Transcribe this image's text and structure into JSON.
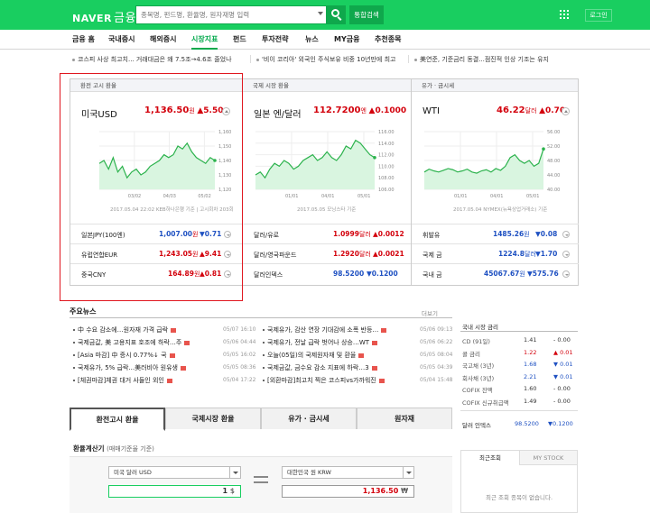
{
  "header": {
    "logo_naver": "NAVER",
    "logo_finance": "금융",
    "search_placeholder": "종목명, 펀드명, 환율명, 원자재명 입력",
    "search_all": "통합검색",
    "login": "로그인"
  },
  "nav": [
    "금융 홈",
    "국내증시",
    "해외증시",
    "시장지표",
    "펀드",
    "투자전략",
    "뉴스",
    "MY금융",
    "추천종목"
  ],
  "nav_active": "시장지표",
  "ticker": [
    "코스피 사상 최고치... 거래대금은 왜 7.5조→4.6조 줄었나",
    "'비이 코리아' 외국인 주식보유 비중 10년만에 최고",
    "美연준, 기준금리 동결...점진적 인상 기조는 유지"
  ],
  "panels": [
    {
      "header": "환전 고시 환율",
      "name": "미국USD",
      "value": "1,136.50",
      "unit": "원",
      "change": "5.50",
      "dir": "up",
      "yticks": [
        "1,160",
        "1,150",
        "1,140",
        "1,130",
        "1,120"
      ],
      "xticks": [
        "03/02",
        "04/03",
        "05/02"
      ],
      "note": "2017.05.04 22:02 KEB하나은행 기준",
      "note2": "고시회차 203회",
      "rows": [
        {
          "label": "일본JPY(100엔)",
          "value": "1,007.00",
          "unit": "원",
          "change": "0.71",
          "dir": "dn"
        },
        {
          "label": "유럽연합EUR",
          "value": "1,243.05",
          "unit": "원",
          "change": "9.41",
          "dir": "up"
        },
        {
          "label": "중국CNY",
          "value": "164.89",
          "unit": "원",
          "change": "0.81",
          "dir": "up"
        }
      ]
    },
    {
      "header": "국제 시장 환율",
      "name": "일본 엔/달러",
      "value": "112.7200",
      "unit": "엔",
      "change": "0.1000",
      "dir": "up",
      "yticks": [
        "116.00",
        "114.00",
        "112.00",
        "110.00",
        "108.00",
        "106.00"
      ],
      "xticks": [
        "01/01",
        "04/01",
        "05/01"
      ],
      "note": "2017.05.05 모닝스타 기준",
      "rows": [
        {
          "label": "달러/유로",
          "value": "1.0999",
          "unit": "달러",
          "change": "0.0012",
          "dir": "up"
        },
        {
          "label": "달러/영국파운드",
          "value": "1.2920",
          "unit": "달러",
          "change": "0.0021",
          "dir": "up"
        },
        {
          "label": "달러인덱스",
          "value": "98.5200",
          "unit": "",
          "change": "0.1200",
          "dir": "dn"
        }
      ]
    },
    {
      "header": "유가 · 금시세",
      "name": "WTI",
      "value": "46.22",
      "unit": "달러",
      "change": "0.70",
      "dir": "up",
      "yticks": [
        "56.00",
        "52.00",
        "48.00",
        "44.00",
        "40.00"
      ],
      "xticks": [
        "01/01",
        "04/01",
        "05/01"
      ],
      "note": "2017.05.04 NYMEX(뉴욕상업거래소) 기준",
      "rows": [
        {
          "label": "휘발유",
          "value": "1485.26",
          "unit": "원",
          "change": "0.08",
          "dir": "dn"
        },
        {
          "label": "국제 금",
          "value": "1224.8",
          "unit": "달러",
          "change": "1.70",
          "dir": "dn"
        },
        {
          "label": "국내 금",
          "value": "45067.67",
          "unit": "원",
          "change": "575.76",
          "dir": "dn"
        }
      ]
    }
  ],
  "news": {
    "title": "주요뉴스",
    "more": "더보기",
    "left": [
      {
        "t": "中 수요 감소에…원자재 가격 급락",
        "d": "05/07 16:10"
      },
      {
        "t": "국제금값, 美 고용지표 호조에 하락…주",
        "d": "05/06 04:44"
      },
      {
        "t": "[Asia 마감] 中 증시 0.77%↓ 국",
        "d": "05/05 16:02"
      },
      {
        "t": "국제유가, 5% 급락...美러비아 원유생",
        "d": "05/05 08:36"
      },
      {
        "t": "[체권마감]체권 대거 사들인 외인",
        "d": "05/04 17:22"
      }
    ],
    "right": [
      {
        "t": "국제유가, 감산 연장 기대감에 소폭 반등…",
        "d": "05/06 09:13"
      },
      {
        "t": "국제유가, 전날 급락 벗어나 상승…WT",
        "d": "05/06 06:22"
      },
      {
        "t": "오늘(05일)의 국제원자재 및 환율",
        "d": "05/05 08:04"
      },
      {
        "t": "국제금값, 금수요 감소 지표에 하락…3",
        "d": "05/05 04:39"
      },
      {
        "t": "[외환마감]최고치 찍은 코스피vs가까워진",
        "d": "05/04 15:48"
      }
    ]
  },
  "market": {
    "title": "국내 시장 금리",
    "rows": [
      {
        "l": "CD (91일)",
        "v": "1.41",
        "c": "0.00",
        "dir": "flat"
      },
      {
        "l": "콜 금리",
        "v": "1.22",
        "c": "0.01",
        "dir": "up"
      },
      {
        "l": "국고채 (3년)",
        "v": "1.68",
        "c": "0.01",
        "dir": "dn"
      },
      {
        "l": "회사채 (3년)",
        "v": "2.21",
        "c": "0.01",
        "dir": "dn"
      },
      {
        "l": "COFIX 잔액",
        "v": "1.60",
        "c": "0.00",
        "dir": "flat"
      },
      {
        "l": "COFIX 신규취급액",
        "v": "1.49",
        "c": "0.00",
        "dir": "flat"
      }
    ],
    "dollar_label": "달러 인덱스",
    "dollar_value": "98.5200",
    "dollar_change": "0.1200"
  },
  "tabs": [
    "환전고시 환율",
    "국제시장 환율",
    "유가 · 금시세",
    "원자재"
  ],
  "calc": {
    "title": "환율계산기",
    "subtitle": "(매매기준율 기준)",
    "from_currency": "미국 달러 USD",
    "from_amount": "1",
    "from_unit": "$",
    "to_currency": "대한민국 원 KRW",
    "to_amount": "1,136.50",
    "to_unit": "₩"
  },
  "recent": {
    "tab1": "최근조회",
    "tab2": "MY STOCK",
    "empty": "최근 조회 종목이 없습니다."
  },
  "colors": {
    "brand": "#19ce60",
    "up": "#d3010c",
    "down": "#1f51c2",
    "highlight": "#e0171f"
  }
}
